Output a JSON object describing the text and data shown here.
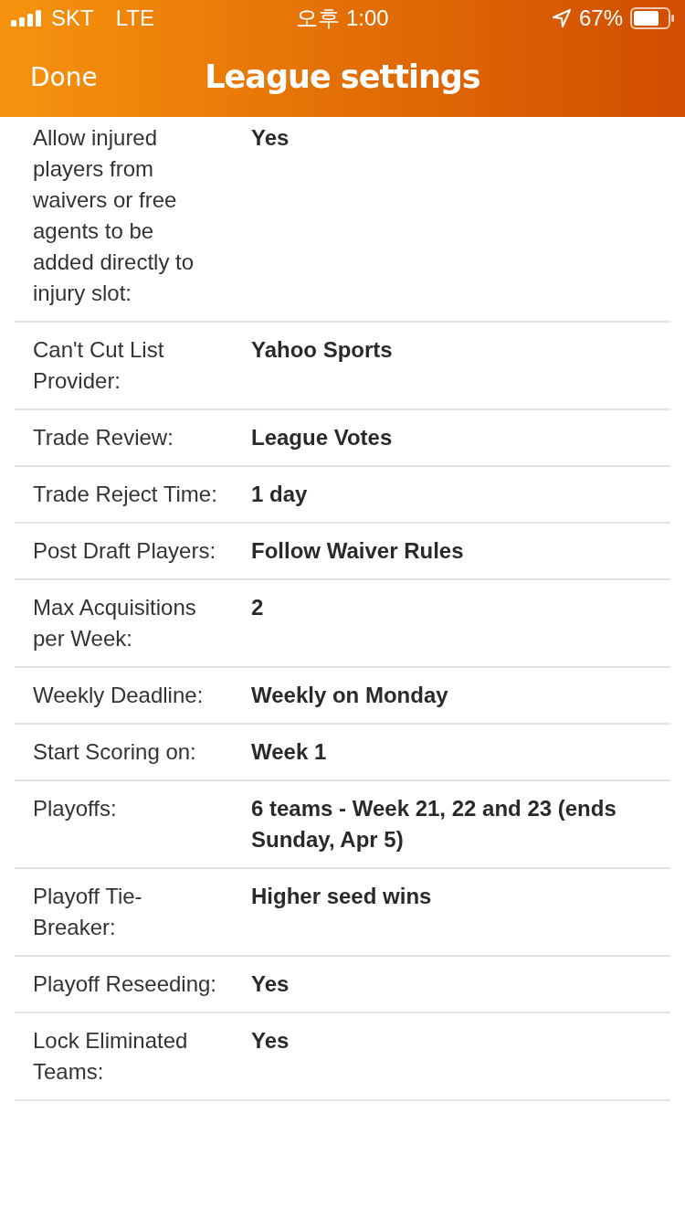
{
  "status_bar": {
    "carrier": "SKT",
    "network": "LTE",
    "time": "오후 1:00",
    "battery": "67%"
  },
  "nav_bar": {
    "done": "Done",
    "title": "League settings"
  },
  "settings": [
    {
      "label": "Allow injured players from waivers or free agents to be added directly to injury slot:",
      "value": "Yes"
    },
    {
      "label": "Can't Cut List Provider:",
      "value": "Yahoo Sports"
    },
    {
      "label": "Trade Review:",
      "value": "League Votes"
    },
    {
      "label": "Trade Reject Time:",
      "value": "1 day"
    },
    {
      "label": "Post Draft Players:",
      "value": "Follow Waiver Rules"
    },
    {
      "label": "Max Acquisitions per Week:",
      "value": "2"
    },
    {
      "label": "Weekly Deadline:",
      "value": "Weekly on Monday"
    },
    {
      "label": "Start Scoring on:",
      "value": "Week 1"
    },
    {
      "label": "Playoffs:",
      "value": "6 teams - Week 21, 22 and 23 (ends Sunday, Apr 5)"
    },
    {
      "label": "Playoff Tie-Breaker:",
      "value": "Higher seed wins"
    },
    {
      "label": "Playoff Reseeding:",
      "value": "Yes"
    },
    {
      "label": "Lock Eliminated Teams:",
      "value": "Yes"
    }
  ]
}
